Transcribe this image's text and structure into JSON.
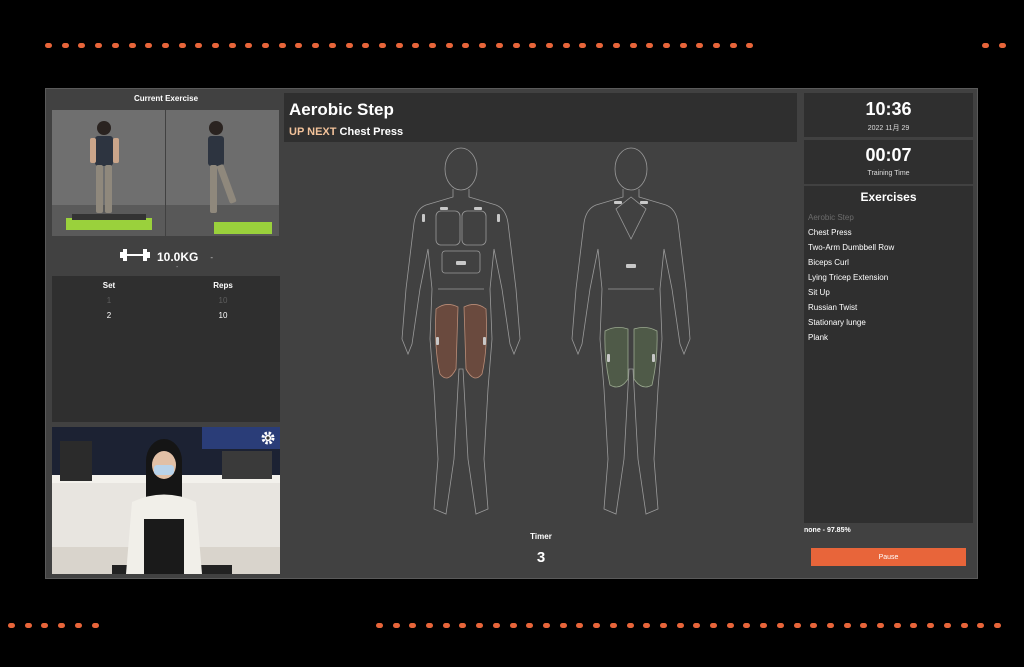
{
  "left": {
    "current_exercise_label": "Current Exercise",
    "weight": "10.0KG",
    "weight_sub": "-",
    "weight_dot": "-",
    "table": {
      "headers": [
        "Set",
        "Reps"
      ],
      "rows": [
        {
          "set": "1",
          "reps": "10",
          "done": true
        },
        {
          "set": "2",
          "reps": "10",
          "done": false
        }
      ]
    }
  },
  "center": {
    "exercise_title": "Aerobic Step",
    "up_next_label": "UP NEXT",
    "up_next_exercise": "Chest Press",
    "timer_label": "Timer",
    "timer_value": "3"
  },
  "right": {
    "clock_time": "10:36",
    "clock_date": "2022 11月 29",
    "training_time": "00:07",
    "training_label": "Training Time",
    "exercises_title": "Exercises",
    "exercises": [
      "Aerobic Step",
      "Chest Press",
      "Two-Arm Dumbbell Row",
      "Biceps Curl",
      "Lying Tricep Extension",
      "Sit Up",
      "Russian Twist",
      "Stationary lunge",
      "Plank"
    ],
    "status": "none - 97.85%",
    "pause_label": "Pause"
  },
  "colors": {
    "accent": "#e8653a",
    "panel": "#2f2f2f",
    "background": "#414141",
    "front_muscle": "#6a4a3e",
    "back_muscle": "#4f5a48"
  },
  "icons": {
    "weight": "dumbbell-icon",
    "settings": "gear-icon"
  }
}
